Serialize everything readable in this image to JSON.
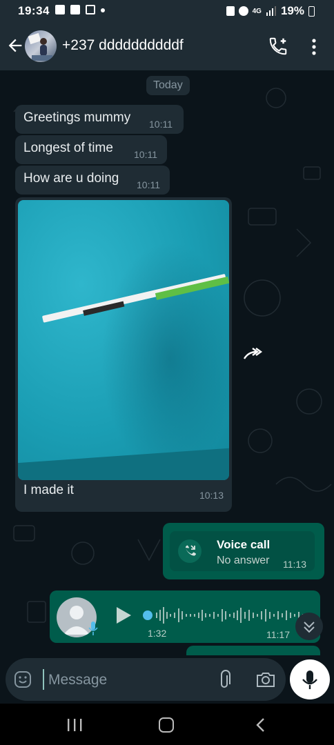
{
  "status_bar": {
    "time": "19:34",
    "network": "4G",
    "battery": "19%"
  },
  "header": {
    "contact_name": "+237 ddddddddddf"
  },
  "chat": {
    "date_chip": "Today",
    "messages_in": [
      {
        "text": "Greetings mummy",
        "time": "10:11"
      },
      {
        "text": "Longest of time",
        "time": "10:11"
      },
      {
        "text": "How are u doing",
        "time": "10:11"
      }
    ],
    "media_message": {
      "caption": "I made it",
      "time": "10:13"
    },
    "call_message": {
      "title": "Voice call",
      "status": "No answer",
      "time": "11:13"
    },
    "voice_message": {
      "duration": "1:32",
      "time": "11:17"
    }
  },
  "composer": {
    "placeholder": "Message"
  },
  "colors": {
    "incoming_bubble": "#1f2c34",
    "outgoing_bubble": "#005c4b",
    "accent": "#53bdeb"
  },
  "icons": [
    "back-arrow-icon",
    "add-call-icon",
    "more-menu-icon",
    "forward-icon",
    "phone-missed-icon",
    "play-icon",
    "mic-icon",
    "emoji-icon",
    "attach-icon",
    "camera-icon",
    "chevron-down-icon"
  ]
}
